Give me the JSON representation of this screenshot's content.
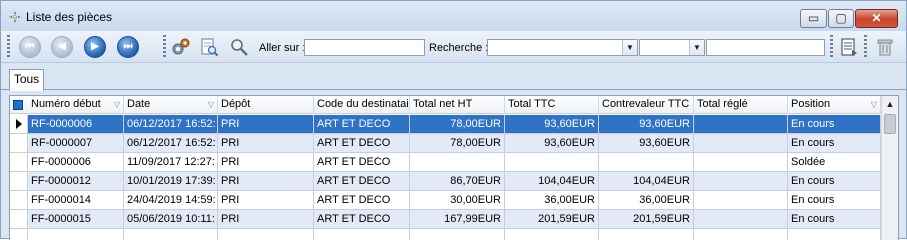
{
  "window": {
    "title": "Liste des pièces",
    "controls": {
      "minimize": "▭",
      "maximize": "▢",
      "close": "✕"
    }
  },
  "toolbar": {
    "nav": [
      "first",
      "previous",
      "next",
      "last"
    ],
    "goto_label": "Aller sur :",
    "goto_value": "",
    "search_label": "Recherche :",
    "search_combo_1": "",
    "search_combo_2": "",
    "icons": [
      "settings-gears-icon",
      "print-preview-icon",
      "search-magnifier-icon",
      "report-icon",
      "delete-icon"
    ]
  },
  "tabs": [
    {
      "label": "Tous"
    }
  ],
  "grid": {
    "columns": [
      "Numéro début",
      "Date",
      "Dépôt",
      "Code du destinataire",
      "Total net HT",
      "Total TTC",
      "Contrevaleur TTC",
      "Total réglé",
      "Position"
    ],
    "rows": [
      [
        "RF-0000006",
        "06/12/2017 16:52:",
        "PRI",
        "ART ET DECO",
        "78,00EUR",
        "93,60EUR",
        "93,60EUR",
        "",
        "En cours"
      ],
      [
        "RF-0000007",
        "06/12/2017 16:52:",
        "PRI",
        "ART ET DECO",
        "78,00EUR",
        "93,60EUR",
        "93,60EUR",
        "",
        "En cours"
      ],
      [
        "FF-0000006",
        "11/09/2017 12:27:",
        "PRI",
        "ART ET DECO",
        "",
        "",
        "",
        "",
        "Soldée"
      ],
      [
        "FF-0000012",
        "10/01/2019 17:39:",
        "PRI",
        "ART ET DECO",
        "86,70EUR",
        "104,04EUR",
        "104,04EUR",
        "",
        "En cours"
      ],
      [
        "FF-0000014",
        "24/04/2019 14:59:",
        "PRI",
        "ART ET DECO",
        "30,00EUR",
        "36,00EUR",
        "36,00EUR",
        "",
        "En cours"
      ],
      [
        "FF-0000015",
        "05/06/2019 10:11:",
        "PRI",
        "ART ET DECO",
        "167,99EUR",
        "201,59EUR",
        "201,59EUR",
        "",
        "En cours"
      ]
    ],
    "selected_row": 0
  },
  "colors": {
    "selection": "#2f73c7",
    "alt_row": "#e4e9f7",
    "chrome": "#dbe6f4"
  }
}
